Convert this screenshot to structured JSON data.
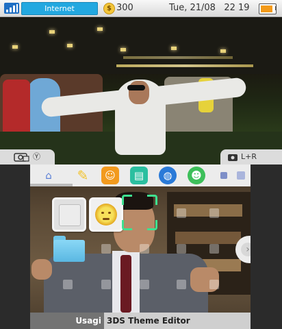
{
  "status_bar": {
    "network": "Internet",
    "coins": "300",
    "coin_glyph": "$",
    "datetime": "Tue, 21/08   22 19",
    "battery_color": "#f39a1a"
  },
  "top_screen": {
    "camera_hint_left": "Ⓨ",
    "camera_hint_right": "L+R"
  },
  "tabs": [
    {
      "icon": "home-settings-icon",
      "glyph": "⌂",
      "color": "#5a7fd6"
    },
    {
      "icon": "pencil-icon",
      "glyph": "✎",
      "color": "#f2c22a"
    },
    {
      "icon": "miiverse-icon",
      "glyph": "☺",
      "color": "#f29a1e"
    },
    {
      "icon": "notifications-icon",
      "glyph": "▤",
      "color": "#2bbfa0"
    },
    {
      "icon": "browser-icon",
      "glyph": "◍",
      "color": "#2a7ad8"
    },
    {
      "icon": "friends-icon",
      "glyph": "☻",
      "color": "#3dbf5a"
    }
  ],
  "home_menu": {
    "user": "Usagi",
    "theme": "3DS Theme Editor",
    "arrow_glyph": "›"
  }
}
